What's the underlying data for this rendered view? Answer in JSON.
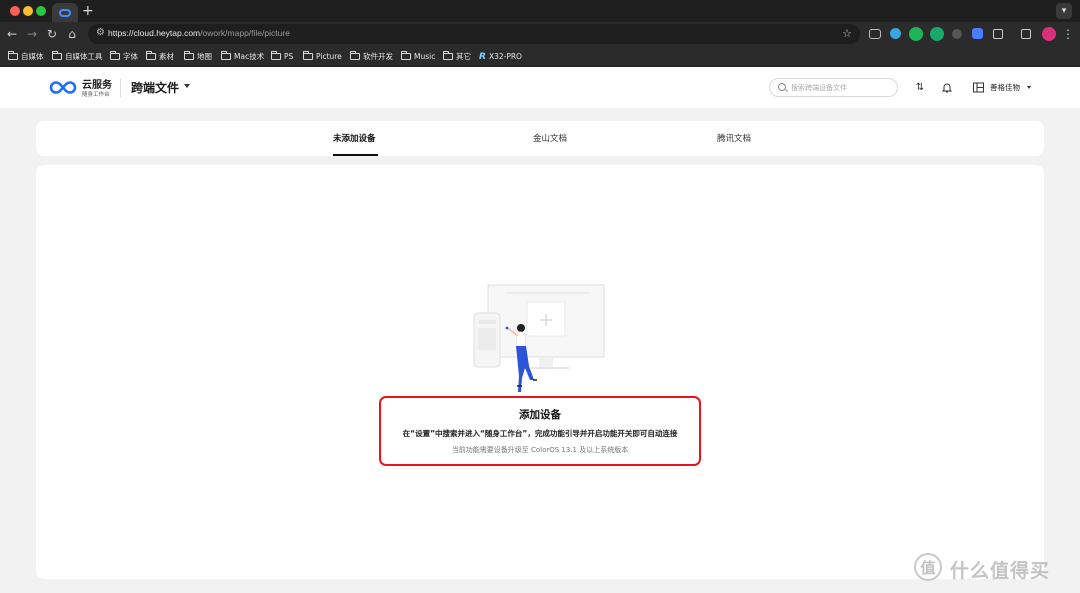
{
  "browser": {
    "url_host": "https://cloud.heytap.com",
    "url_path": "/owork/mapp/file/picture",
    "new_tab_symbol": "+",
    "bookmarks": [
      "自媒体",
      "自媒体工具",
      "字体",
      "素材",
      "地图",
      "Mac技术",
      "PS",
      "Picture",
      "软件开发",
      "Music",
      "其它",
      "X32-PRO"
    ]
  },
  "header": {
    "brand_title": "云服务",
    "brand_subtitle": "随身工作台",
    "page_title": "跨端文件",
    "search_placeholder": "搜索跨端设备文件",
    "user_name": "善格佳物"
  },
  "tabs": [
    {
      "label": "未添加设备",
      "active": true
    },
    {
      "label": "金山文档",
      "active": false
    },
    {
      "label": "腾讯文档",
      "active": false
    }
  ],
  "empty_state": {
    "title": "添加设备",
    "description": "在“设置”中搜索并进入“随身工作台”，完成功能引导并开启功能开关即可自动连接",
    "note": "当前功能需要设备升级至 ColorOS 13.1 及以上系统版本",
    "highlight_color": "#e8141c"
  },
  "watermark": {
    "glyph": "值",
    "text": "什么值得买"
  },
  "colors": {
    "brand_blue": "#1f6fff",
    "figure_blue": "#2b54d8"
  }
}
